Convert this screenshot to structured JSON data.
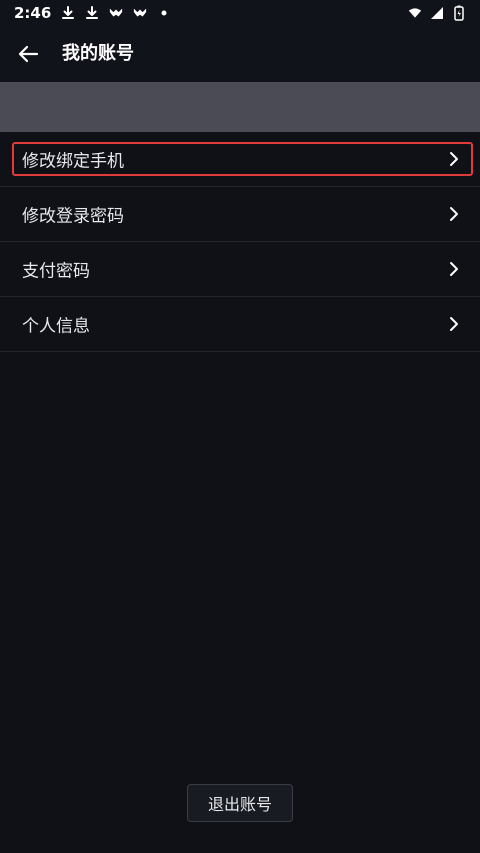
{
  "status_bar": {
    "time": "2:46",
    "left_icons": [
      "download-icon",
      "download-icon",
      "app-icon",
      "app-icon",
      "dot-icon"
    ],
    "right_icons": [
      "wifi-icon",
      "signal-icon",
      "battery-icon"
    ]
  },
  "header": {
    "title": "我的账号"
  },
  "list": {
    "items": [
      {
        "label": "修改绑定手机",
        "icon": "chevron-right-icon"
      },
      {
        "label": "修改登录密码",
        "icon": "chevron-right-icon"
      },
      {
        "label": "支付密码",
        "icon": "chevron-right-icon"
      },
      {
        "label": "个人信息",
        "icon": "chevron-right-icon"
      }
    ]
  },
  "footer": {
    "logout_label": "退出账号"
  },
  "colors": {
    "background": "#0f1117",
    "banner": "#4a4b54",
    "divider": "#22252e",
    "highlight": "#e23a3a",
    "text": "#e7e8ec"
  }
}
